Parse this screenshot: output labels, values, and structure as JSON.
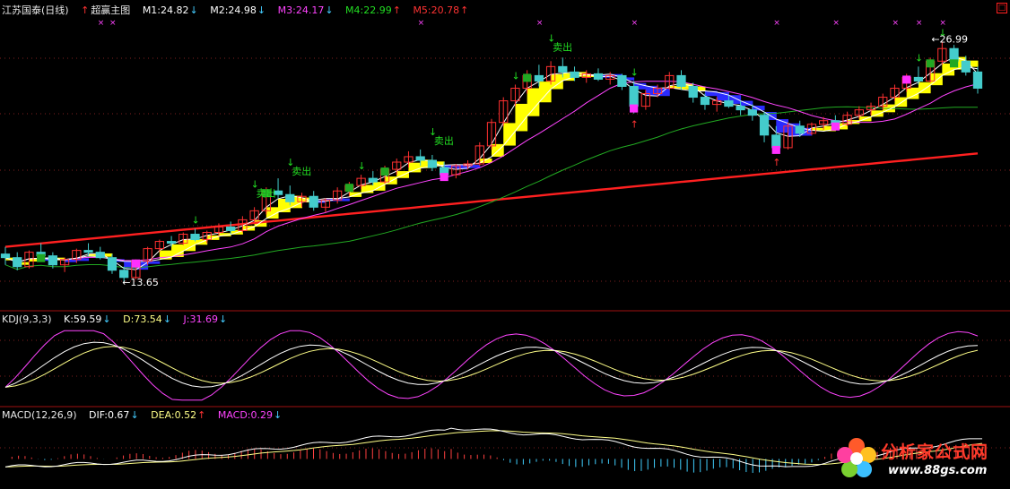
{
  "header": {
    "stock_name": "江苏国泰(日线)",
    "indicator_name": "超赢主图",
    "m1": "M1:24.82",
    "m2": "M2:24.98",
    "m3": "M3:24.17",
    "m4": "M4:22.99",
    "m5": "M5:20.78"
  },
  "kdj_panel": {
    "name": "KDJ(9,3,3)",
    "k": "K:59.59",
    "d": "D:73.54",
    "j": "J:31.69"
  },
  "macd_panel": {
    "name": "MACD(12,26,9)",
    "dif": "DIF:0.67",
    "dea": "DEA:0.52",
    "macd": "MACD:0.29"
  },
  "watermark": {
    "title": "分析家公式网",
    "url": "www.88gs.com"
  },
  "chart_data": {
    "type": "line",
    "panels": [
      "price",
      "kdj",
      "macd"
    ],
    "price_labels": {
      "high_label": "26.99",
      "low_label": "13.65"
    },
    "signal_label": "卖出",
    "moving_averages": [
      {
        "name": "M1",
        "value": 24.82,
        "color": "#ffffff"
      },
      {
        "name": "M2",
        "value": 24.98,
        "color": "#ffffff"
      },
      {
        "name": "M3",
        "value": 24.17,
        "color": "#ff44ff"
      },
      {
        "name": "M4",
        "value": 22.99,
        "color": "#22dd22"
      },
      {
        "name": "M5",
        "value": 20.78,
        "color": "#ff2020"
      }
    ],
    "price_range": [
      13.65,
      26.99
    ],
    "candles_approx": [
      [
        15.2,
        15.6,
        14.6,
        15.0
      ],
      [
        15.0,
        15.3,
        14.3,
        14.5
      ],
      [
        14.5,
        15.4,
        14.4,
        15.3
      ],
      [
        15.3,
        15.8,
        15.0,
        15.1
      ],
      [
        15.1,
        15.3,
        14.4,
        14.6
      ],
      [
        14.6,
        15.0,
        14.2,
        14.9
      ],
      [
        14.9,
        15.5,
        14.7,
        15.4
      ],
      [
        15.4,
        15.8,
        15.1,
        15.3
      ],
      [
        15.3,
        15.6,
        14.9,
        15.0
      ],
      [
        15.0,
        15.2,
        14.1,
        14.3
      ],
      [
        14.3,
        14.5,
        13.65,
        13.9
      ],
      [
        13.9,
        14.9,
        13.8,
        14.8
      ],
      [
        14.8,
        15.6,
        14.6,
        15.5
      ],
      [
        15.5,
        16.0,
        15.3,
        15.9
      ],
      [
        15.9,
        16.2,
        15.6,
        15.8
      ],
      [
        15.8,
        16.4,
        15.7,
        16.3
      ],
      [
        16.3,
        16.6,
        15.9,
        16.0
      ],
      [
        16.0,
        16.5,
        15.8,
        16.4
      ],
      [
        16.4,
        16.9,
        16.2,
        16.7
      ],
      [
        16.7,
        17.0,
        16.3,
        16.5
      ],
      [
        16.5,
        17.3,
        16.4,
        17.1
      ],
      [
        17.1,
        17.8,
        16.9,
        17.6
      ],
      [
        17.6,
        18.9,
        17.4,
        18.7
      ],
      [
        18.7,
        19.4,
        18.3,
        18.5
      ],
      [
        18.5,
        19.0,
        17.9,
        18.1
      ],
      [
        18.1,
        18.6,
        17.8,
        18.4
      ],
      [
        18.4,
        18.7,
        17.6,
        17.8
      ],
      [
        17.8,
        18.3,
        17.5,
        18.2
      ],
      [
        18.2,
        18.9,
        18.0,
        18.7
      ],
      [
        18.7,
        19.2,
        18.4,
        19.0
      ],
      [
        19.0,
        19.6,
        18.8,
        19.4
      ],
      [
        19.4,
        19.8,
        19.0,
        19.2
      ],
      [
        19.2,
        20.1,
        19.1,
        19.9
      ],
      [
        19.9,
        20.5,
        19.6,
        20.3
      ],
      [
        20.3,
        20.9,
        20.0,
        20.6
      ],
      [
        20.6,
        21.0,
        20.1,
        20.4
      ],
      [
        20.4,
        20.7,
        19.8,
        20.0
      ],
      [
        20.0,
        20.3,
        19.4,
        19.6
      ],
      [
        19.6,
        20.2,
        19.4,
        20.1
      ],
      [
        20.1,
        20.4,
        19.9,
        20.2
      ],
      [
        20.2,
        21.4,
        20.1,
        21.2
      ],
      [
        21.2,
        22.7,
        21.0,
        22.5
      ],
      [
        22.5,
        23.9,
        22.3,
        23.7
      ],
      [
        23.7,
        24.6,
        23.4,
        24.4
      ],
      [
        24.4,
        25.4,
        24.1,
        25.1
      ],
      [
        25.1,
        25.7,
        24.5,
        24.8
      ],
      [
        24.8,
        25.9,
        24.6,
        25.6
      ],
      [
        25.6,
        26.1,
        25.0,
        25.3
      ],
      [
        25.3,
        25.6,
        24.8,
        25.0
      ],
      [
        25.0,
        25.4,
        24.7,
        25.2
      ],
      [
        25.2,
        25.5,
        24.8,
        24.9
      ],
      [
        24.9,
        25.3,
        24.6,
        25.1
      ],
      [
        25.1,
        25.2,
        24.3,
        24.5
      ],
      [
        24.5,
        24.8,
        23.0,
        23.4
      ],
      [
        23.4,
        24.3,
        23.2,
        24.1
      ],
      [
        24.1,
        24.6,
        23.9,
        24.4
      ],
      [
        24.4,
        25.3,
        24.3,
        25.1
      ],
      [
        25.1,
        25.4,
        24.3,
        24.5
      ],
      [
        24.5,
        24.7,
        23.6,
        23.9
      ],
      [
        23.9,
        24.1,
        23.2,
        23.5
      ],
      [
        23.5,
        23.9,
        23.1,
        23.7
      ],
      [
        23.7,
        24.0,
        23.3,
        23.4
      ],
      [
        23.4,
        23.7,
        22.9,
        23.2
      ],
      [
        23.2,
        23.5,
        22.6,
        22.9
      ],
      [
        22.9,
        23.1,
        21.4,
        21.8
      ],
      [
        21.8,
        22.3,
        20.9,
        21.1
      ],
      [
        21.1,
        22.5,
        21.0,
        22.3
      ],
      [
        22.3,
        22.6,
        21.7,
        21.9
      ],
      [
        21.9,
        22.5,
        21.8,
        22.4
      ],
      [
        22.4,
        22.8,
        22.1,
        22.6
      ],
      [
        22.6,
        22.9,
        22.2,
        22.4
      ],
      [
        22.4,
        23.1,
        22.3,
        22.9
      ],
      [
        22.9,
        23.4,
        22.7,
        23.2
      ],
      [
        23.2,
        23.6,
        22.9,
        23.4
      ],
      [
        23.4,
        24.1,
        23.2,
        23.9
      ],
      [
        23.9,
        24.6,
        23.7,
        24.4
      ],
      [
        24.4,
        25.2,
        24.2,
        25.0
      ],
      [
        25.0,
        25.6,
        24.6,
        24.8
      ],
      [
        24.8,
        26.1,
        24.7,
        25.9
      ],
      [
        25.9,
        26.99,
        25.7,
        26.6
      ],
      [
        26.6,
        26.8,
        25.6,
        25.9
      ],
      [
        25.9,
        26.2,
        25.1,
        25.3
      ],
      [
        25.3,
        25.6,
        24.1,
        24.4
      ]
    ],
    "kdj_range": [
      -10,
      110
    ],
    "macd_range": [
      -0.8,
      1.3
    ]
  }
}
